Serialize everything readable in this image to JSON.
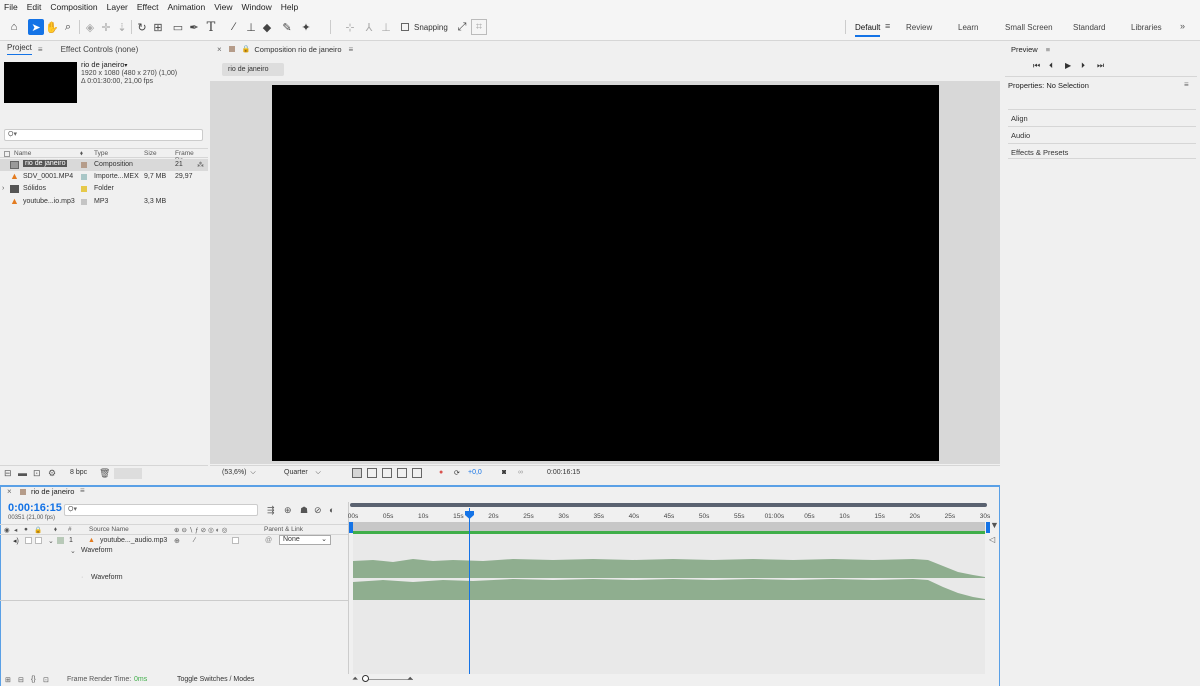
{
  "menu": [
    "File",
    "Edit",
    "Composition",
    "Layer",
    "Effect",
    "Animation",
    "View",
    "Window",
    "Help"
  ],
  "toolbar": {
    "snapping_label": "Snapping"
  },
  "workspaces": {
    "active": "Default",
    "items": [
      "Review",
      "Learn",
      "Small Screen",
      "Standard",
      "Libraries"
    ]
  },
  "project_panel": {
    "tab_project": "Project",
    "tab_effect_controls": "Effect Controls (none)",
    "selected_name": "rio de janeiro",
    "selected_dims": "1920 x 1080  (480 x 270) (1,00)",
    "selected_duration": "Δ 0:01:30:00, 21,00 fps",
    "search_placeholder": "Ọ▾",
    "columns": [
      "Name",
      "Type",
      "Size",
      "Frame Ra..."
    ],
    "items": [
      {
        "name": "rio de janeiro",
        "type": "Composition",
        "size": "",
        "fps": "21",
        "color": "#b59c8a"
      },
      {
        "name": "SDV_0001.MP4",
        "type": "Importe...MEX",
        "size": "9,7 MB",
        "fps": "29,97",
        "color": "#a9c7c7"
      },
      {
        "name": "Sólidos",
        "type": "Folder",
        "size": "",
        "fps": "",
        "color": "#e6c94a"
      },
      {
        "name": "youtube...io.mp3",
        "type": "MP3",
        "size": "3,3 MB",
        "fps": "",
        "color": "#c4c4c4"
      }
    ],
    "bpc": "8 bpc"
  },
  "comp_viewer": {
    "tab_label": "Composition rio de janeiro",
    "subtab": "rio de janeiro",
    "zoom": "(53,6%)",
    "resolution": "Quarter",
    "exposure": "+0,0",
    "timecode": "0:00:16:15"
  },
  "right_panel": {
    "preview_title": "Preview",
    "properties_title": "Properties: No Selection",
    "sections": [
      "Align",
      "Audio",
      "Effects & Presets"
    ]
  },
  "timeline": {
    "comp_name": "rio de janeiro",
    "timecode": "0:00:16:15",
    "frame_info": "00351 (21,00 fps)",
    "search_placeholder": "Ọ▾",
    "col_number": "#",
    "col_source": "Source Name",
    "col_parent": "Parent & Link",
    "layer": {
      "index": "1",
      "name": "youtube..._audio.mp3",
      "parent": "None"
    },
    "waveform_group": "Waveform",
    "waveform_item": "Waveform",
    "ruler_ticks": [
      "00s",
      "05s",
      "10s",
      "15s",
      "20s",
      "25s",
      "30s",
      "35s",
      "40s",
      "45s",
      "50s",
      "55s",
      "01:00s",
      "05s",
      "10s",
      "15s",
      "20s",
      "25s",
      "30s"
    ],
    "playhead_time": "0:00:16:15",
    "render_label": "Frame Render Time:",
    "render_value": "0ms",
    "toggle_label": "Toggle Switches / Modes"
  }
}
